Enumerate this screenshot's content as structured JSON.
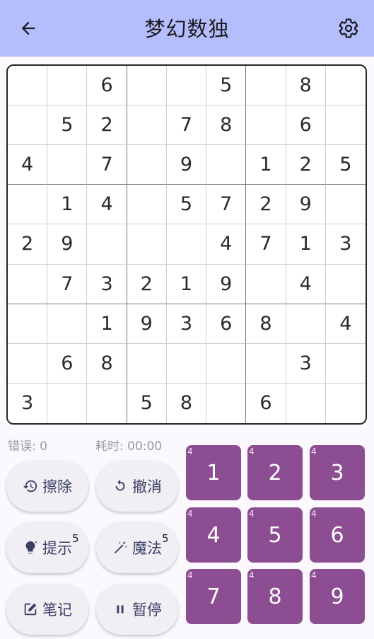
{
  "header": {
    "title": "梦幻数独",
    "background": "#b5befc"
  },
  "board": {
    "rows": [
      [
        "",
        "",
        "6",
        "",
        "",
        "5",
        "",
        "8",
        ""
      ],
      [
        "",
        "5",
        "2",
        "",
        "7",
        "8",
        "",
        "6",
        ""
      ],
      [
        "4",
        "",
        "7",
        "",
        "9",
        "",
        "1",
        "2",
        "5"
      ],
      [
        "",
        "1",
        "4",
        "",
        "5",
        "7",
        "2",
        "9",
        ""
      ],
      [
        "2",
        "9",
        "",
        "",
        "",
        "4",
        "7",
        "1",
        "3"
      ],
      [
        "",
        "7",
        "3",
        "2",
        "1",
        "9",
        "",
        "4",
        ""
      ],
      [
        "",
        "",
        "1",
        "9",
        "3",
        "6",
        "8",
        "",
        "4"
      ],
      [
        "",
        "6",
        "8",
        "",
        "",
        "",
        "",
        "3",
        ""
      ],
      [
        "3",
        "",
        "",
        "5",
        "8",
        "",
        "6",
        "",
        ""
      ]
    ]
  },
  "status": {
    "errors": "错误: 0",
    "time": "耗时: 00:00"
  },
  "actions": {
    "erase": {
      "label": "擦除",
      "icon": "history-icon"
    },
    "undo": {
      "label": "撤消",
      "icon": "undo-icon"
    },
    "hint": {
      "label": "提示",
      "icon": "lightbulb-icon",
      "badge": "5"
    },
    "magic": {
      "label": "魔法",
      "icon": "magic-wand-icon",
      "badge": "5"
    },
    "notes": {
      "label": "笔记",
      "icon": "edit-icon"
    },
    "pause": {
      "label": "暂停",
      "icon": "pause-icon"
    }
  },
  "keypad": {
    "color": "#8d4d92",
    "keys": [
      {
        "digit": "1",
        "remaining": "4"
      },
      {
        "digit": "2",
        "remaining": "4"
      },
      {
        "digit": "3",
        "remaining": "4"
      },
      {
        "digit": "4",
        "remaining": "4"
      },
      {
        "digit": "5",
        "remaining": "4"
      },
      {
        "digit": "6",
        "remaining": "4"
      },
      {
        "digit": "7",
        "remaining": "4"
      },
      {
        "digit": "8",
        "remaining": "4"
      },
      {
        "digit": "9",
        "remaining": "4"
      }
    ]
  }
}
